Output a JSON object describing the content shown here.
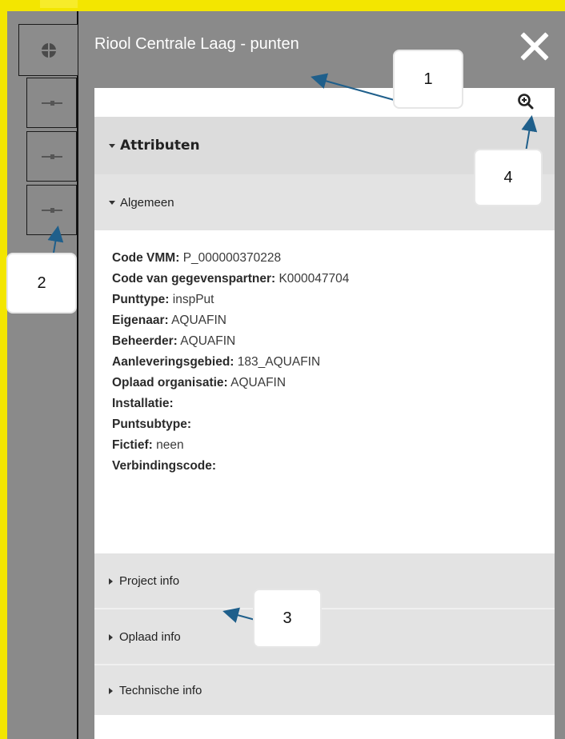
{
  "panel": {
    "title": "Riool Centrale Laag - punten",
    "close_icon": "close-icon",
    "zoom_icon": "zoom-in-icon"
  },
  "tabs": [
    {
      "icon": "globe-icon"
    },
    {
      "icon": "line-segment-icon"
    },
    {
      "icon": "line-segment-icon"
    },
    {
      "icon": "line-segment-icon"
    }
  ],
  "sections": {
    "attributes": "Attributen",
    "general": "Algemeen",
    "project": "Project info",
    "upload": "Oplaad info",
    "technical": "Technische info"
  },
  "attributes": [
    {
      "key": "Code VMM:",
      "value": "P_000000370228"
    },
    {
      "key": "Code van gegevenspartner:",
      "value": "K000047704"
    },
    {
      "key": "Punttype:",
      "value": "inspPut"
    },
    {
      "key": "Eigenaar:",
      "value": "AQUAFIN"
    },
    {
      "key": "Beheerder:",
      "value": "AQUAFIN"
    },
    {
      "key": "Aanleveringsgebied:",
      "value": "183_AQUAFIN"
    },
    {
      "key": "Oplaad organisatie:",
      "value": "AQUAFIN"
    },
    {
      "key": "Installatie:",
      "value": ""
    },
    {
      "key": "Puntsubtype:",
      "value": ""
    },
    {
      "key": "Fictief:",
      "value": "neen"
    },
    {
      "key": "Verbindingscode:",
      "value": ""
    }
  ],
  "callouts": [
    "1",
    "2",
    "3",
    "4"
  ],
  "colors": {
    "panel_background": "#8a8a8a",
    "section_header": "#dcdcdc",
    "accent_yellow": "#f3e600",
    "callout_arrow": "#1f5f8b"
  }
}
